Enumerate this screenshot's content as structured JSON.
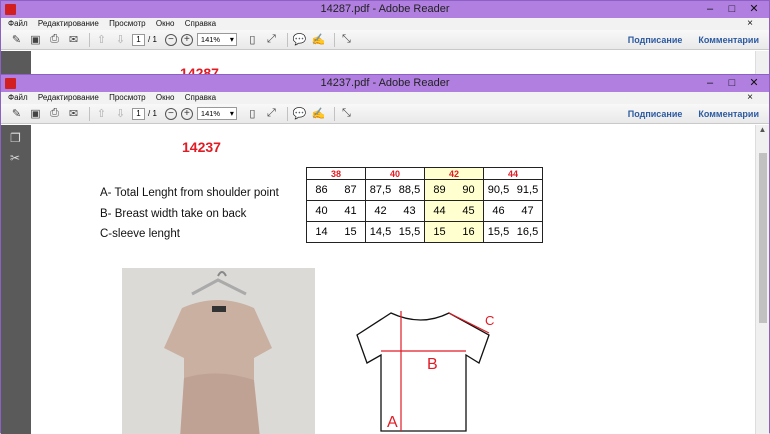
{
  "back_window": {
    "title": "14287.pdf - Adobe Reader",
    "peek_title": "14287"
  },
  "window": {
    "title": "14237.pdf - Adobe Reader",
    "controls": {
      "minimize": "–",
      "maximize": "□",
      "close": "✕"
    }
  },
  "menu": [
    "Файл",
    "Редактирование",
    "Просмотр",
    "Окно",
    "Справка"
  ],
  "toolbar": {
    "page_current": "1",
    "page_total": "/ 1",
    "zoom": "141%",
    "sign_label": "Подписание",
    "comments_label": "Комментарии"
  },
  "document": {
    "title": "14237",
    "rows": [
      "A- Total Lenght from shoulder point",
      "B- Breast width take on back",
      "C-sleeve lenght"
    ],
    "size_headers": [
      "38",
      "40",
      "42",
      "44"
    ],
    "highlight_column": "42",
    "size_values": [
      [
        [
          "86",
          "87"
        ],
        [
          "87,5",
          "88,5"
        ],
        [
          "89",
          "90"
        ],
        [
          "90,5",
          "91,5"
        ]
      ],
      [
        [
          "40",
          "41"
        ],
        [
          "42",
          "43"
        ],
        [
          "44",
          "45"
        ],
        [
          "46",
          "47"
        ]
      ],
      [
        [
          "14",
          "15"
        ],
        [
          "14,5",
          "15,5"
        ],
        [
          "15",
          "16"
        ],
        [
          "15,5",
          "16,5"
        ]
      ]
    ],
    "diagram_labels": {
      "a": "A",
      "b": "B",
      "c": "C"
    }
  },
  "colors": {
    "title_bar": "#b07fe0",
    "accent_red": "#e01b24",
    "link_blue": "#2c5aa0",
    "highlight": "#ffffd0"
  }
}
